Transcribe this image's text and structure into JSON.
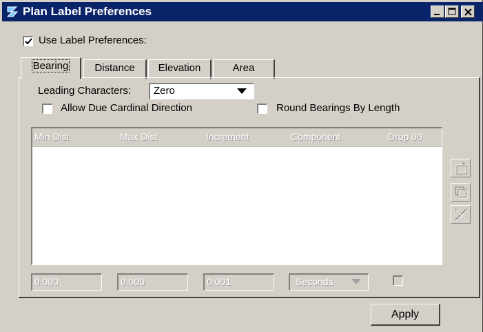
{
  "window": {
    "title": "Plan Label Preferences",
    "titlebar_color": "#0a246a",
    "icons": [
      "app-logo-icon",
      "minimize-icon",
      "maximize-icon",
      "close-icon"
    ]
  },
  "use_label_preferences": {
    "label": "Use Label Preferences:",
    "checked": true
  },
  "tabs": [
    {
      "label": "Bearing",
      "active": true
    },
    {
      "label": "Distance",
      "active": false
    },
    {
      "label": "Elevation",
      "active": false
    },
    {
      "label": "Area",
      "active": false
    }
  ],
  "bearing": {
    "leading_characters": {
      "label": "Leading Characters:",
      "value": "Zero"
    },
    "allow_due_cardinal": {
      "label": "Allow Due Cardinal Direction",
      "checked": false
    },
    "round_bearings": {
      "label": "Round Bearings By Length",
      "checked": false
    },
    "table": {
      "columns": [
        "Min Dist",
        "Max Dist",
        "Increment",
        "Component",
        "Drop 00"
      ],
      "rows": []
    },
    "side_buttons": [
      "add-row-icon",
      "copy-row-icon",
      "delete-row-icon"
    ],
    "inputs": {
      "min_dist": "0.000",
      "max_dist": "0.000",
      "increment": "0.001",
      "component": "Seconds",
      "drop00_checked": false
    }
  },
  "apply_label": "Apply"
}
